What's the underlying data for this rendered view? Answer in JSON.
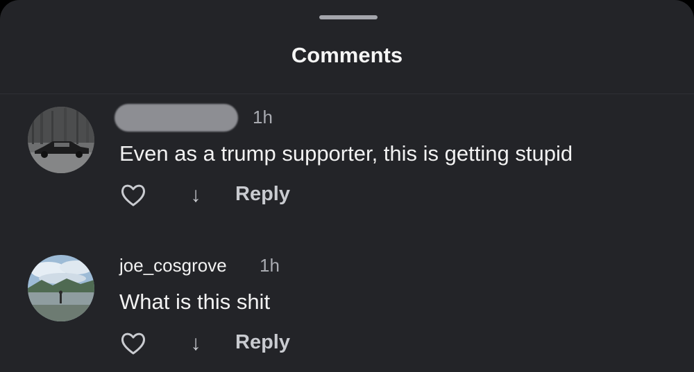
{
  "sheet": {
    "title": "Comments"
  },
  "comments": [
    {
      "username": "",
      "username_redacted": true,
      "time": "1h",
      "text": "Even as a trump supporter, this is getting stupid",
      "reply_label": "Reply",
      "avatar": "car-photo-avatar"
    },
    {
      "username": "joe_cosgrove",
      "username_redacted": false,
      "time": "1h",
      "text": "What is this shit",
      "reply_label": "Reply",
      "avatar": "lake-photo-avatar"
    }
  ],
  "icons": {
    "like": "heart-outline-icon",
    "downvote": "arrow-down-icon"
  },
  "colors": {
    "background": "#232428",
    "text_primary": "#f2f2f2",
    "text_secondary": "#a9abb1"
  }
}
